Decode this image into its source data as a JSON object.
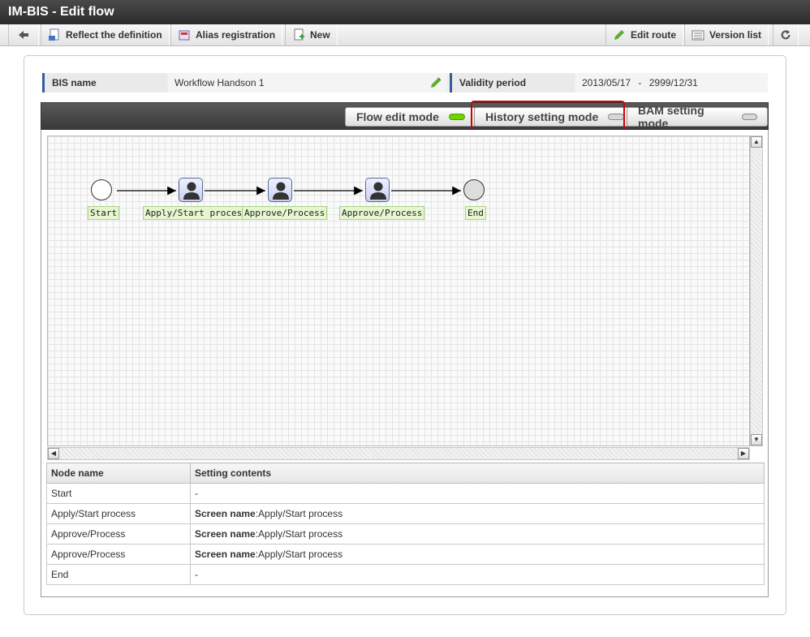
{
  "window": {
    "title": "IM-BIS - Edit flow"
  },
  "toolbar": {
    "back_icon": "arrow-left-icon",
    "reflect_label": "Reflect the definition",
    "alias_label": "Alias registration",
    "new_label": "New",
    "edit_route_label": "Edit route",
    "version_list_label": "Version list",
    "reload_icon": "reload-icon"
  },
  "info": {
    "bis_name_label": "BIS name",
    "bis_name_value": "Workflow Handson 1",
    "validity_label": "Validity period",
    "validity_from": "2013/05/17",
    "validity_sep": "-",
    "validity_to": "2999/12/31"
  },
  "modes": {
    "flow_edit": "Flow edit mode",
    "history_setting": "History setting mode",
    "bam_setting": "BAM setting mode",
    "active": "flow_edit",
    "highlight": "history_setting",
    "highlight_color": "#d30000"
  },
  "flow": {
    "nodes": [
      {
        "type": "start",
        "label": "Start"
      },
      {
        "type": "user",
        "label": "Apply/Start process"
      },
      {
        "type": "user",
        "label": "Approve/Process"
      },
      {
        "type": "user",
        "label": "Approve/Process"
      },
      {
        "type": "end",
        "label": "End"
      }
    ]
  },
  "table": {
    "headers": [
      "Node name",
      "Setting contents"
    ],
    "rows": [
      {
        "node": "Start",
        "key": "",
        "value": "-"
      },
      {
        "node": "Apply/Start process",
        "key": "Screen name",
        "value": ":Apply/Start process"
      },
      {
        "node": "Approve/Process",
        "key": "Screen name",
        "value": ":Apply/Start process"
      },
      {
        "node": "Approve/Process",
        "key": "Screen name",
        "value": ":Apply/Start process"
      },
      {
        "node": "End",
        "key": "",
        "value": "-"
      }
    ]
  }
}
